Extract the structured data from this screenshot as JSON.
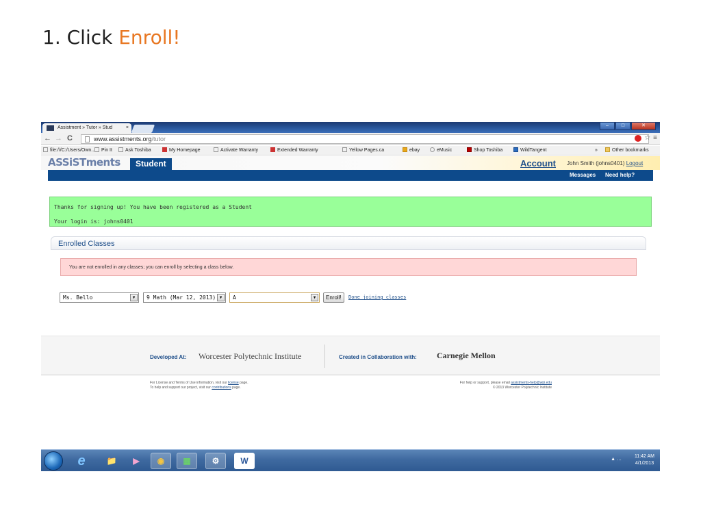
{
  "slide": {
    "step": "1. Click ",
    "highlight": "Enroll!"
  },
  "browser": {
    "tab_title": "Assistment » Tutor » Stud",
    "tab_close": "×",
    "url_host": "www.assistments.org",
    "url_path": "/tutor",
    "bookmarks": [
      "file:///C:/Users/Own...",
      "Pin It",
      "Ask Toshiba",
      "My Homepage",
      "Activate Warranty",
      "Extended Warranty",
      "Yellow Pages.ca",
      "ebay",
      "eMusic",
      "Shop Toshiba",
      "WildTangent"
    ],
    "bookmarks_more": "»",
    "other_bookmarks": "Other bookmarks"
  },
  "site": {
    "logo": "ASSiSTments",
    "role_tab": "Student",
    "account_link": "Account",
    "user": "John Smith (johns0401)",
    "logout": "Logout",
    "nav_messages": "Messages",
    "nav_help": "Need help?"
  },
  "success": {
    "line1": "Thanks for signing up! You have been registered as a Student",
    "line2": "Your login is: johns0401"
  },
  "enrolled": {
    "title": "Enrolled Classes",
    "alert": "You are not enrolled in any classes; you can enroll by selecting a class below.",
    "teacher_select": "Ms. Bello",
    "class_select": "9 Math (Mar 12, 2013)",
    "section_select": "A",
    "enroll_button": "Enroll!",
    "done_link": "Done joining classes"
  },
  "footer": {
    "developed_label": "Developed At:",
    "developed_name": "Worcester Polytechnic Institute",
    "collab_label": "Created in Collaboration with:",
    "collab_name": "Carnegie Mellon",
    "license_pre": "For License and Terms of Use information, visit our",
    "license_link": "license",
    "license_post": "page.",
    "support_pre": "To help and support our project, visit our",
    "support_link": "contributions",
    "support_post": "page.",
    "help_pre": "For help or support, please email",
    "help_email": "assistments-help@wpi.edu",
    "copyright": "© 2013 Worcester Polytechnic Institute"
  },
  "taskbar": {
    "time": "11:42 AM",
    "date": "4/1/2013",
    "word_label": "W"
  }
}
